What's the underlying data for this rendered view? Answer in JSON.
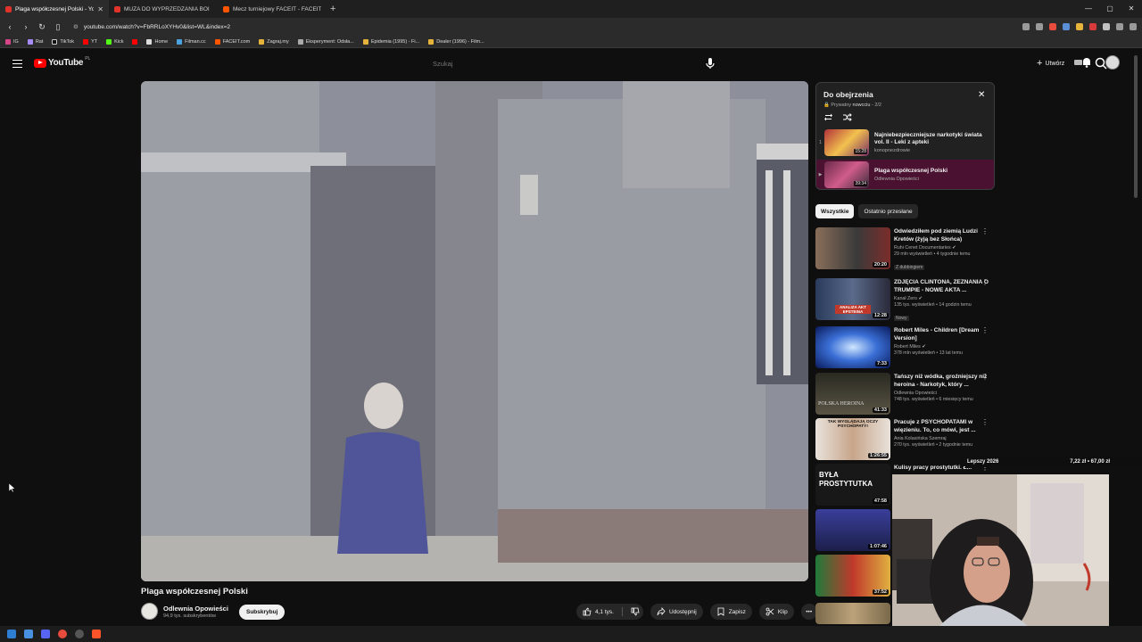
{
  "browser": {
    "tabs": [
      {
        "label": "Plaga współczesnej Polski - Yo",
        "active": true,
        "icon": "youtube-icon"
      },
      {
        "label": "MUZA DO WYPRZEDZANIA BOI",
        "active": false,
        "icon": "youtube-icon"
      },
      {
        "label": "Mecz turniejowy FACEIT - FACEIT.com",
        "active": false,
        "icon": "faceit-icon"
      }
    ],
    "url": "youtube.com/watch?v=FbRRLoXYHv0&list=WL&index=2",
    "bookmarks": [
      "IG",
      "Rat",
      "TikTok",
      "YT",
      "Kick",
      "Home",
      "Filman.cc",
      "FACEIT.com",
      "Zagraj.my",
      "Eksperyment: Odsła...",
      "Epidemia (1995) - Fi...",
      "Dealer (1996) - Film..."
    ]
  },
  "header": {
    "logo": "YouTube",
    "logo_region": "PL",
    "search_placeholder": "Szukaj",
    "create_label": "Utwórz"
  },
  "video": {
    "title": "Plaga współczesnej Polski",
    "channel": "Odlewnia Opowieści",
    "subscribers": "94,9 tys. subskrybentów",
    "subscribe_label": "Subskrybuj",
    "likes": "4,1 tys.",
    "share_label": "Udostępnij",
    "save_label": "Zapisz",
    "clip_label": "Klip"
  },
  "playlist": {
    "title": "Do obejrzenia",
    "meta_prefix": "Prywatny",
    "meta_owner": "nowcciu",
    "meta_count": "2/2",
    "items": [
      {
        "index": "1",
        "title": "Najniebezpieczniejsze narkotyki świata vol. II - Leki z apteki",
        "channel": "konopnezdrowie",
        "duration": "15:28",
        "current": false
      },
      {
        "index": "▶",
        "title": "Plaga współczesnej Polski",
        "channel": "Odlewnia Opowieści",
        "duration": "39:34",
        "current": true
      }
    ]
  },
  "chips": [
    "Wszystkie",
    "Ostatnio przesłane"
  ],
  "recommendations": [
    {
      "title": "Odwiedziłem pod ziemią Ludzi Kretów (żyją bez Słońca)",
      "channel": "Ruhi Cenet Documentaries ✔",
      "meta": "29 mln wyświetleń • 4 tygodnie temu",
      "badge": "Z dubbingiem",
      "duration": "20:20"
    },
    {
      "title": "ZDJĘCIA CLINTONA, ZEZNANIA O TRUMPIE - NOWE AKTA ...",
      "channel": "Kanał Zero ✔",
      "meta": "135 tys. wyświetleń • 14 godzin temu",
      "badge": "Nowy",
      "duration": "12:28",
      "thumb_caption": "ANALIZA AKT EPSTEINA"
    },
    {
      "title": "Robert Miles - Children [Dream Version]",
      "channel": "Robert Miles ✔",
      "meta": "378 mln wyświetleń • 13 lat temu",
      "badge": "",
      "duration": "7:33"
    },
    {
      "title": "Tańszy niż wódka, groźniejszy niż heroina - Narkotyk, który ...",
      "channel": "Odlewnia Opowieści",
      "meta": "748 tys. wyświetleń • 6 miesięcy temu",
      "badge": "",
      "duration": "41:33",
      "thumb_caption": "POLSKA HEROINA"
    },
    {
      "title": "Pracuje z PSYCHOPATAMI w więzieniu. To, co mówi, jest ...",
      "channel": "Ania Kolasińska Szemraj",
      "meta": "270 tys. wyświetleń • 2 tygodnie temu",
      "badge": "",
      "duration": "1:26:55",
      "thumb_caption": "TAK WYGLĄDAJĄ OCZY PSYCHOPATY!"
    },
    {
      "title": "Kulisy pracy prostytutki. Ł...",
      "channel": "",
      "meta": "",
      "badge": "",
      "duration": "47:58",
      "thumb_caption": "BYŁA PROSTYTUTKA"
    },
    {
      "title": "",
      "channel": "",
      "meta": "",
      "badge": "",
      "duration": "1:07:46"
    },
    {
      "title": "",
      "channel": "",
      "meta": "",
      "badge": "",
      "duration": "37:52"
    }
  ],
  "overlay": {
    "label": "Lepszy 2026",
    "value": "7,22 zł • 67,00 zł"
  },
  "colors": {
    "background": "#0f0f0f",
    "brand_red": "#ff0000",
    "playlist_current": "#4a1230"
  }
}
